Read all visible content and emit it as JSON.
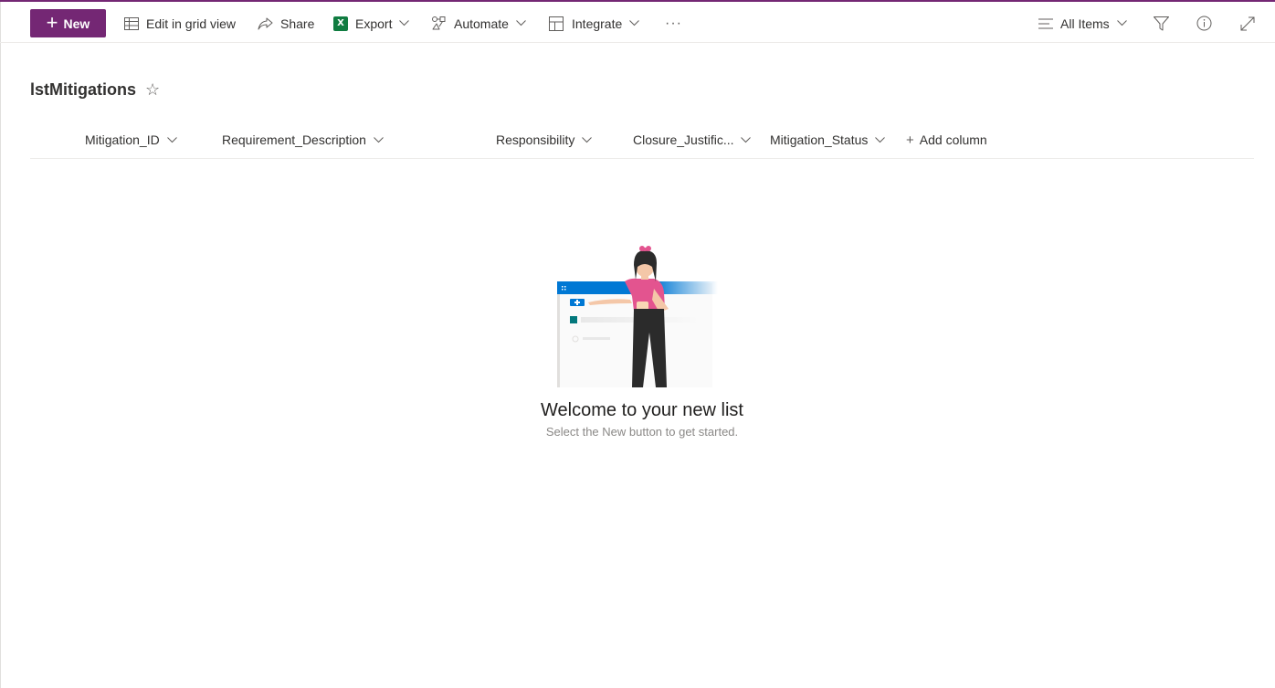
{
  "toolbar": {
    "new_label": "New",
    "edit_grid_label": "Edit in grid view",
    "share_label": "Share",
    "export_label": "Export",
    "excel_glyph": "X",
    "automate_label": "Automate",
    "integrate_label": "Integrate",
    "more_label": "···",
    "view_label": "All Items",
    "icons": [
      "plus-icon",
      "grid-icon",
      "share-icon",
      "excel-icon",
      "automate-icon",
      "integrate-icon",
      "more-icon",
      "view-list-icon",
      "filter-icon",
      "info-icon",
      "expand-icon"
    ]
  },
  "list": {
    "title": "lstMitigations",
    "favorite_glyph": "☆"
  },
  "columns": [
    {
      "label": "Mitigation_ID"
    },
    {
      "label": "Requirement_Description"
    },
    {
      "label": "Responsibility"
    },
    {
      "label": "Closure_Justific..."
    },
    {
      "label": "Mitigation_Status"
    }
  ],
  "add_column_label": "Add column",
  "empty_state": {
    "heading": "Welcome to your new list",
    "subtext": "Select the New button to get started."
  },
  "colors": {
    "accent": "#742774",
    "excel": "#107c41",
    "banner_blue": "#0078d4",
    "person_shirt": "#e3548f",
    "teal": "#03787c"
  }
}
